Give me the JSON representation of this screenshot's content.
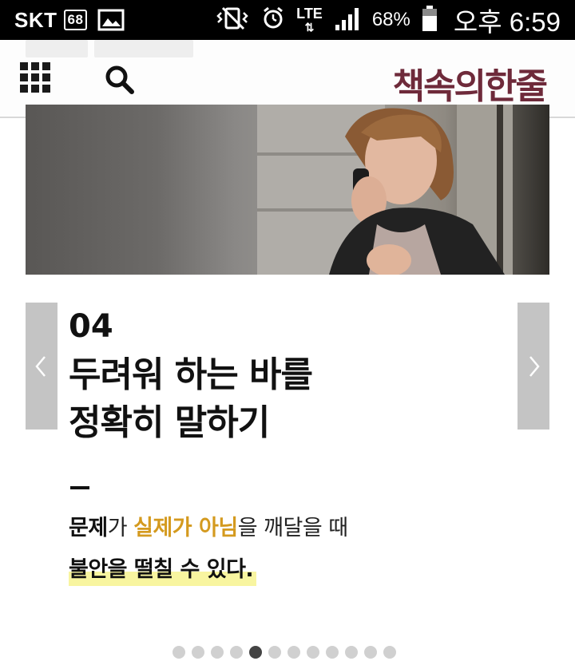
{
  "status_bar": {
    "carrier": "SKT",
    "carrier_badge": "68",
    "network": "LTE",
    "battery_percent": "68%",
    "time": "오후 6:59",
    "icons": [
      "image-icon",
      "vibrate-icon",
      "alarm-icon",
      "signal-icon",
      "battery-icon"
    ]
  },
  "header": {
    "logo": "책속의한줄",
    "logo_color": "#6e2a3a",
    "menu_icon": "grid-menu-icon",
    "search_icon": "search-icon"
  },
  "card": {
    "number": "04",
    "title_line1": "두려워 하는 바를",
    "title_line2": "정확히 말하기",
    "body": {
      "part1": "문제",
      "part2": "가 ",
      "part3": "실제가 아님",
      "part4": "을 깨달을 때"
    },
    "highlight_line": "불안을 떨칠 수 있다.",
    "accent_color": "#d49a1f",
    "highlight_color": "#f8f5a0"
  },
  "carousel": {
    "total": 12,
    "active_index": 4
  }
}
